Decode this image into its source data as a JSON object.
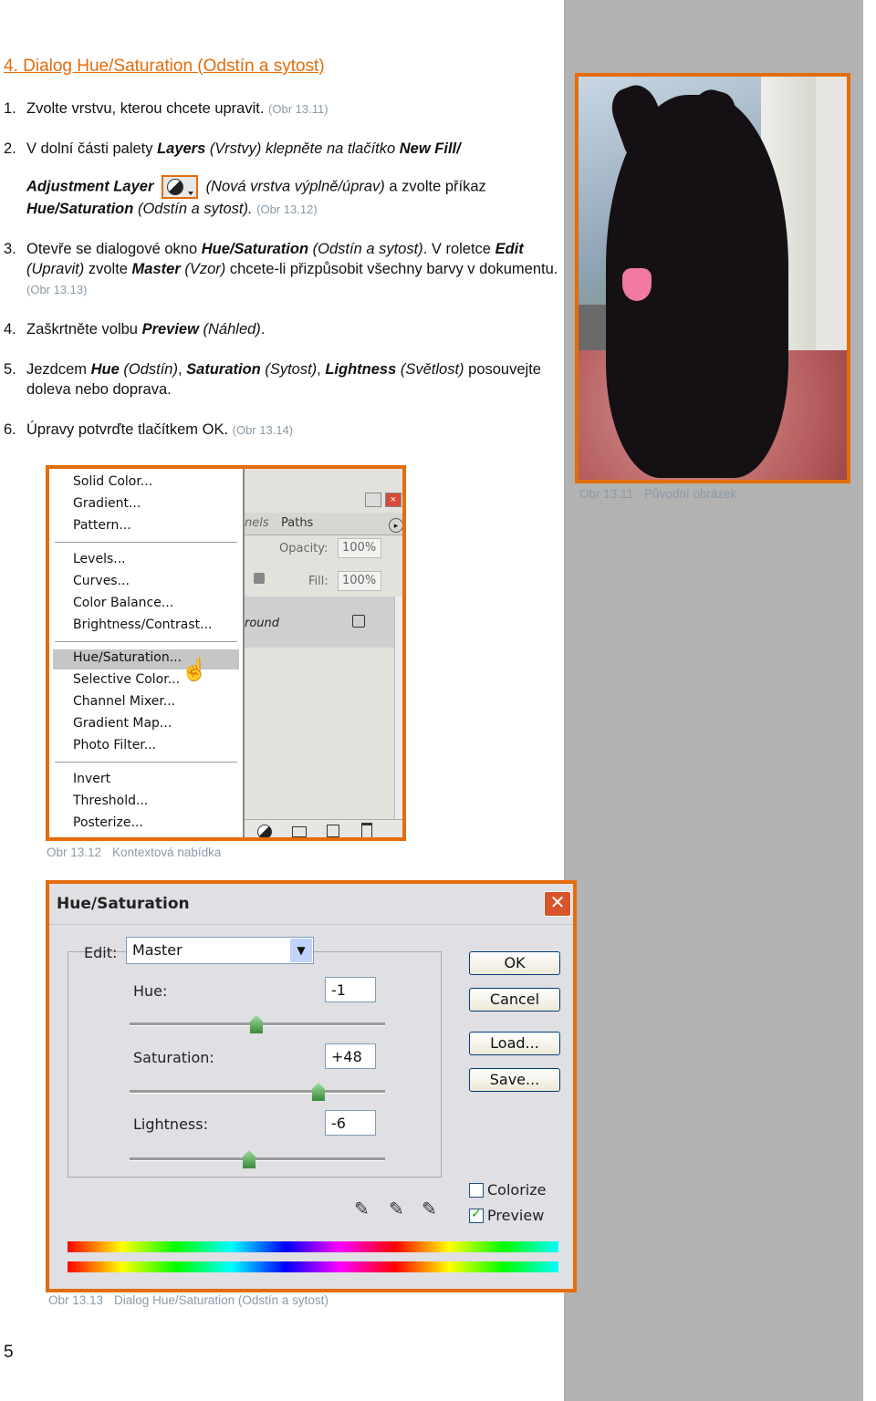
{
  "heading": "4. Dialog Hue/Saturation (Odstín a sytost)",
  "steps": {
    "s1": {
      "num": "1.",
      "text": "Zvolte vrstvu, kterou chcete upravit.",
      "ref": "(Obr 13.11)"
    },
    "s2": {
      "num": "2.",
      "a": "V dolní části palety ",
      "b": "Layers",
      "c": " (Vrstvy) klepněte na tlačítko ",
      "d": "New Fill/",
      "e": "Adjustment Layer",
      "f": "(Nová vrstva výplně/úprav)",
      "g": " a zvolte příkaz ",
      "h": "Hue/Saturation",
      "i": " (Odstín a sytost).",
      "ref": "(Obr 13.12)"
    },
    "s3": {
      "num": "3.",
      "a": "Otevře se dialogové okno ",
      "b": "Hue/Saturation",
      "c": " (Odstín a sytost)",
      "d": ". V roletce ",
      "e": "Edit",
      "f": " (Upravit)",
      "g": " zvolte ",
      "h": "Master",
      "i": " (Vzor)",
      "j": " chcete-li přizpůsobit všechny barvy v dokumentu.",
      "ref": "(Obr 13.13)"
    },
    "s4": {
      "num": "4.",
      "a": "Zaškrtněte volbu ",
      "b": "Preview",
      "c": " (Náhled)",
      "d": "."
    },
    "s5": {
      "num": "5.",
      "a": "Jezdcem ",
      "b": "Hue",
      "c": " (Odstín)",
      "d": ", ",
      "e": "Saturation",
      "f": " (Sytost)",
      "g": ", ",
      "h": "Lightness",
      "i": " (Světlost)",
      "j": " posouvejte doleva nebo doprava."
    },
    "s6": {
      "num": "6.",
      "text": "Úpravy potvrďte tlačítkem OK.",
      "ref": "(Obr 13.14)"
    }
  },
  "captions": {
    "c11": {
      "num": "Obr 13.11",
      "text": "Původní obrázek"
    },
    "c12": {
      "num": "Obr 13.12",
      "text": "Kontextová nabídka"
    },
    "c13": {
      "num": "Obr 13.13",
      "text": "Dialog Hue/Saturation (Odstín a sytost)"
    }
  },
  "page_number": "5",
  "context_menu": {
    "items": [
      "Solid Color...",
      "Gradient...",
      "Pattern...",
      "Levels...",
      "Curves...",
      "Color Balance...",
      "Brightness/Contrast...",
      "Hue/Saturation...",
      "Selective Color...",
      "Channel Mixer...",
      "Gradient Map...",
      "Photo Filter...",
      "Invert",
      "Threshold...",
      "Posterize..."
    ],
    "highlighted": "Hue/Saturation...",
    "panel": {
      "tab1": "nels",
      "tab2": "Paths",
      "opacity_label": "Opacity:",
      "opacity": "100%",
      "fill_label": "Fill:",
      "fill": "100%",
      "layer": "round"
    }
  },
  "dialog": {
    "title": "Hue/Saturation",
    "edit_label": "Edit:",
    "edit_value": "Master",
    "hue_label": "Hue:",
    "hue": "-1",
    "sat_label": "Saturation:",
    "sat": "+48",
    "light_label": "Lightness:",
    "light": "-6",
    "ok": "OK",
    "cancel": "Cancel",
    "load": "Load...",
    "save": "Save...",
    "colorize": "Colorize",
    "colorize_checked": false,
    "preview": "Preview",
    "preview_checked": true
  },
  "colors": {
    "accent": "#e46c0a",
    "sidebar": "#b2b2b2",
    "caption": "#8a9aa8"
  }
}
